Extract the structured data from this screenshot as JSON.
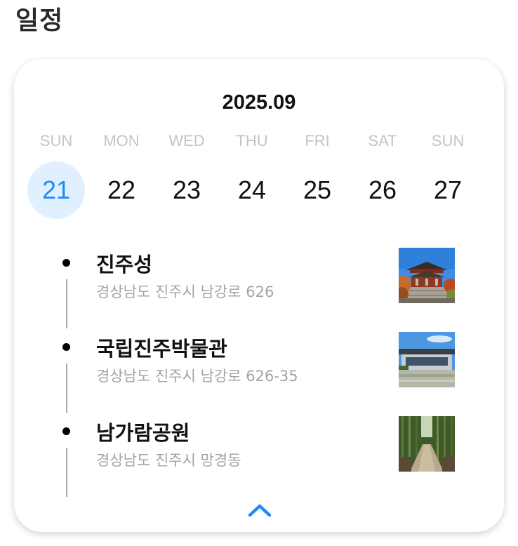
{
  "page": {
    "title": "일정"
  },
  "calendar": {
    "month": "2025.09",
    "weekdays": [
      "SUN",
      "MON",
      "WED",
      "THU",
      "FRI",
      "SAT",
      "SUN"
    ],
    "dates": [
      "21",
      "22",
      "23",
      "24",
      "25",
      "26",
      "27"
    ],
    "selected_date": "21",
    "accent_color": "#1d8cf8",
    "selected_bg": "#e1f0ff"
  },
  "schedule": {
    "items": [
      {
        "name": "진주성",
        "address": "경상남도 진주시 남강로 626",
        "thumbnail": "fortress-photo"
      },
      {
        "name": "국립진주박물관",
        "address": "경상남도 진주시 남강로 626-35",
        "thumbnail": "museum-photo"
      },
      {
        "name": "남가람공원",
        "address": "경상남도 진주시 망경동",
        "thumbnail": "bamboo-park-photo"
      }
    ]
  },
  "controls": {
    "collapse_icon": "chevron-up-icon"
  }
}
